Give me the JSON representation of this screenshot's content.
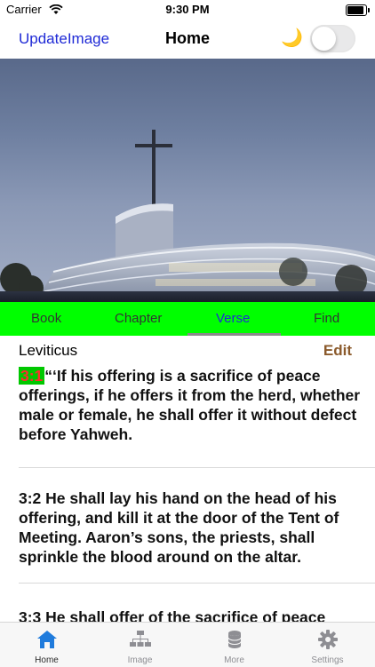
{
  "status_bar": {
    "carrier": "Carrier",
    "time": "9:30 PM"
  },
  "nav": {
    "left_button": "UpdateImage",
    "title": "Home",
    "night_mode_icon": "moon-icon"
  },
  "tabs": [
    {
      "label": "Book"
    },
    {
      "label": "Chapter"
    },
    {
      "label": "Verse"
    },
    {
      "label": "Find"
    }
  ],
  "active_tab": "Verse",
  "content": {
    "book": "Leviticus",
    "edit_label": "Edit",
    "verse1_num": "3:1",
    "verse1_text": "“‘If his offering is a sacrifice of peace offerings, if he offers it from the herd, whether male or female, he shall offer it without defect before Yahweh.",
    "verse2": "3:2 He shall lay his hand on the head of his offering, and kill it at the door of the Tent of Meeting. Aaron’s sons, the priests, shall sprinkle the blood around on the altar.",
    "verse3": "3:3 He shall offer of the sacrifice of peace"
  },
  "tabbar": [
    {
      "label": "Home",
      "icon": "home-icon"
    },
    {
      "label": "Image",
      "icon": "hierarchy-icon"
    },
    {
      "label": "More",
      "icon": "database-icon"
    },
    {
      "label": "Settings",
      "icon": "gear-icon"
    }
  ],
  "colors": {
    "accent": "#1f2ad6",
    "tab_bar_bg": "#00ff00",
    "verse_highlight": "#00c800",
    "verse_number": "#ff2d2d",
    "edit": "#8b5a2b"
  }
}
